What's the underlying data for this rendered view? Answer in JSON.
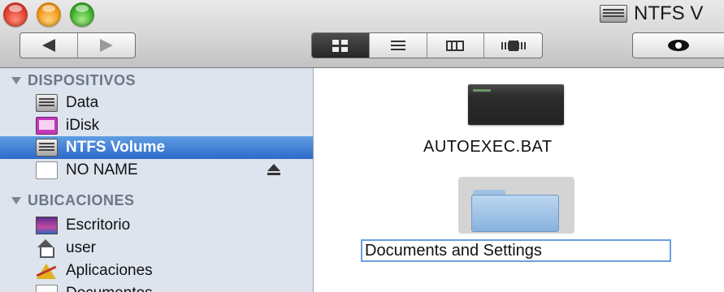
{
  "window": {
    "title": "NTFS V",
    "traffic_lights": {
      "close": "#e0402f",
      "minimize": "#f19a1c",
      "zoom": "#3fae2c"
    }
  },
  "toolbar": {
    "back_icon": "left-arrow-icon",
    "forward_icon": "right-arrow-icon",
    "views": [
      "icon-view",
      "list-view",
      "column-view",
      "cover-flow-view"
    ],
    "active_view": "icon-view",
    "quicklook_icon": "eye-icon"
  },
  "sidebar": {
    "sections": [
      {
        "title": "DISPOSITIVOS",
        "items": [
          {
            "label": "Data",
            "icon": "hard-disk-icon"
          },
          {
            "label": "iDisk",
            "icon": "idisk-icon"
          },
          {
            "label": "NTFS Volume",
            "icon": "hard-disk-icon",
            "selected": true
          },
          {
            "label": "NO NAME",
            "icon": "removable-disk-icon",
            "eject": true
          }
        ]
      },
      {
        "title": "UBICACIONES",
        "items": [
          {
            "label": "Escritorio",
            "icon": "desktop-icon"
          },
          {
            "label": "user",
            "icon": "home-icon"
          },
          {
            "label": "Aplicaciones",
            "icon": "applications-icon"
          },
          {
            "label": "Documentos",
            "icon": "documents-icon"
          }
        ]
      }
    ],
    "selection_color": "#3d7fd6"
  },
  "content": {
    "files": [
      {
        "name": "AUTOEXEC.BAT",
        "icon": "terminal-file-icon"
      },
      {
        "name": "Documents and Settings",
        "icon": "folder-icon",
        "renaming": true
      }
    ]
  }
}
